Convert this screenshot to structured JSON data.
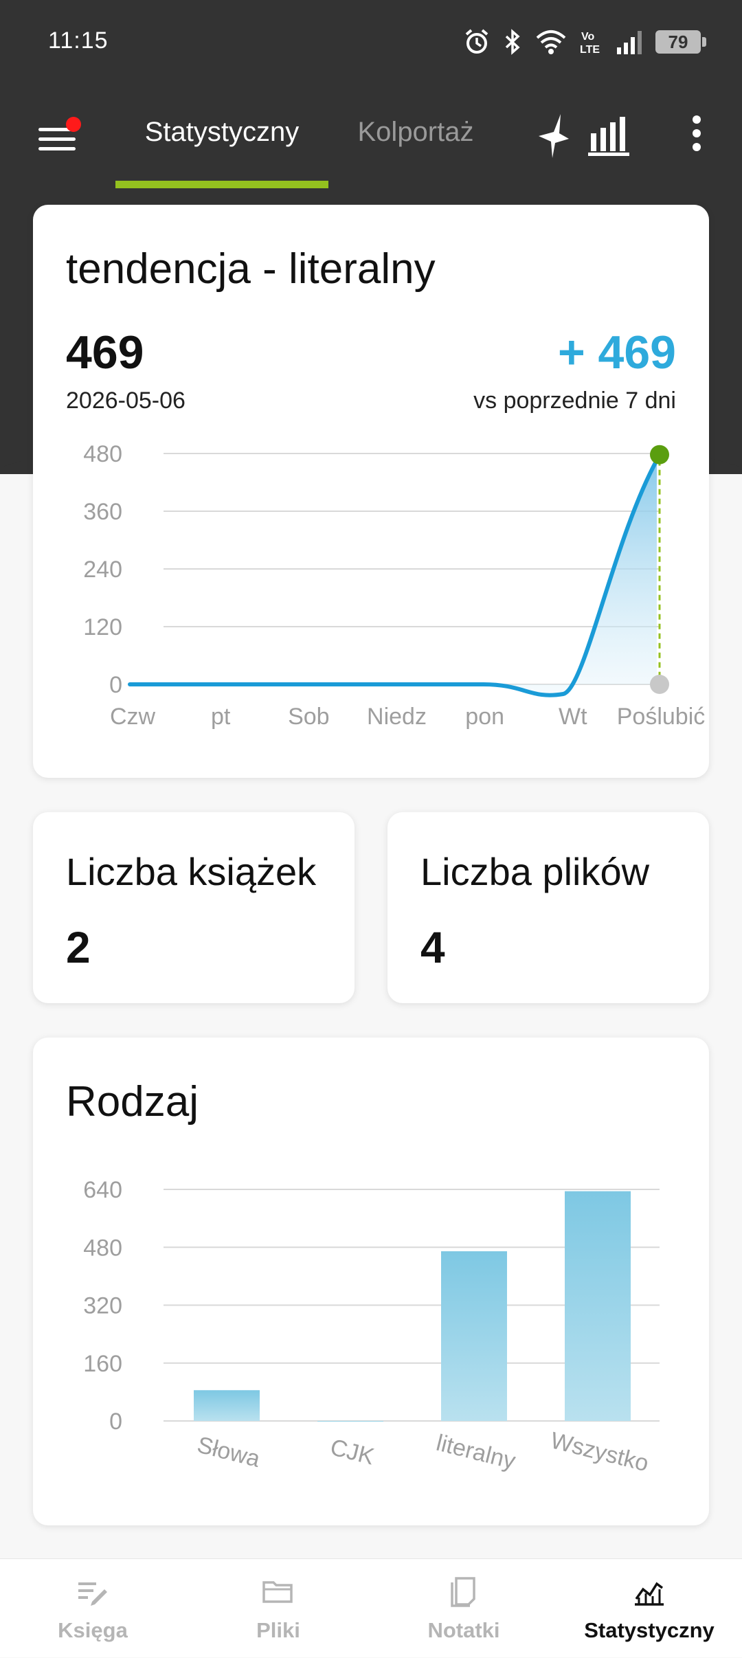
{
  "status_bar": {
    "time": "11:15",
    "battery": "79"
  },
  "tabs": [
    {
      "label": "Statystyczny",
      "active": true
    },
    {
      "label": "Kolportaż",
      "active": false
    }
  ],
  "trend_card": {
    "title": "tendencja - literalny",
    "value": "469",
    "date": "2026-05-06",
    "delta": "+ 469",
    "delta_caption": "vs poprzednie 7 dni"
  },
  "stats": [
    {
      "title": "Liczba książek",
      "value": "2"
    },
    {
      "title": "Liczba plików",
      "value": "4"
    }
  ],
  "genre_card": {
    "title": "Rodzaj"
  },
  "chart_data": [
    {
      "type": "area",
      "title": "tendencja - literalny",
      "categories": [
        "Czw",
        "pt",
        "Sob",
        "Niedz",
        "pon",
        "Wt",
        "Poślubić"
      ],
      "values": [
        0,
        0,
        0,
        0,
        0,
        0,
        469
      ],
      "yticks": [
        0,
        120,
        240,
        360,
        480
      ],
      "ylim": [
        0,
        480
      ],
      "grid": true,
      "line_color": "#1a9bd7",
      "highlight_color": "#5a9e0f"
    },
    {
      "type": "bar",
      "title": "Rodzaj",
      "categories": [
        "Słowa",
        "CJK",
        "literalny",
        "Wszystko"
      ],
      "values": [
        85,
        0,
        469,
        635
      ],
      "yticks": [
        0,
        160,
        320,
        480,
        640
      ],
      "ylim": [
        0,
        640
      ],
      "grid": true,
      "bar_color": "#8ecfe6"
    }
  ],
  "bottom_nav": [
    {
      "label": "Księga",
      "icon": "edit-notes-icon",
      "active": false
    },
    {
      "label": "Pliki",
      "icon": "folder-icon",
      "active": false
    },
    {
      "label": "Notatki",
      "icon": "notes-icon",
      "active": false
    },
    {
      "label": "Statystyczny",
      "icon": "stats-chart-icon",
      "active": true
    }
  ],
  "colors": {
    "header": "#333333",
    "accent": "#94c11f",
    "delta": "#2eaadc"
  }
}
